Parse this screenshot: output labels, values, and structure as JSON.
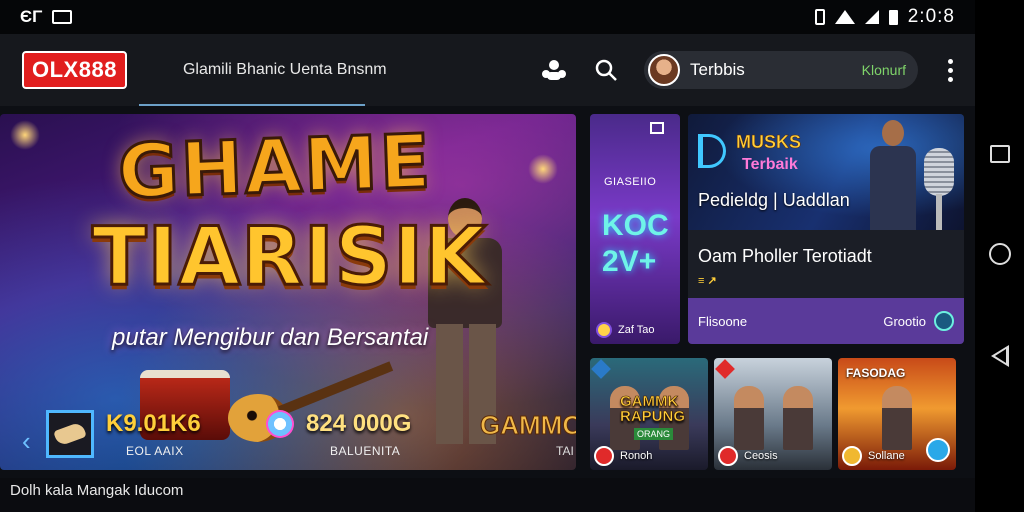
{
  "status_bar": {
    "left_text": "ЄΓ",
    "clock": "2:0:8"
  },
  "header": {
    "logo": "OLX888",
    "nav_text": "Glamili Bhanic  Uenta  Bnsnm",
    "profile_name": "Terbbis",
    "profile_status": "Klonurf"
  },
  "hero": {
    "title_line1": "GHAME",
    "title_line2": "TIARISIK",
    "subtitle": "putar Mengibur dan Bersantai",
    "stat1_value": "K9.01K6",
    "stat1_label": "EOL AAIX",
    "stat2_value": "824 000G",
    "stat2_label": "BALUENITA",
    "side_title": "GAMMON",
    "side_sub": "TAI"
  },
  "card_violet": {
    "label": "GIASEIIO",
    "big_line1": "KOC",
    "big_line2": "2V+",
    "foot": "Zaf Tao"
  },
  "feature": {
    "brand_line1": "MUSKS",
    "brand_line2": "Terbaik",
    "caption": "Pedieldg | Uaddlan",
    "heading": "Oam Pholler Terotiadt",
    "tag": "≡ ↗",
    "bar_label": "Flisoone",
    "bar_action": "Grootio"
  },
  "thumbs": [
    {
      "title": "GAMMK\nRAPUNG",
      "sub": "ORANG",
      "foot": "Ronoh"
    },
    {
      "top": "",
      "foot": "Ceosis"
    },
    {
      "top": "FASODAG",
      "foot": "Sollane"
    }
  ],
  "footer": {
    "caption": "Dolh kala Mangak Iducom"
  },
  "colors": {
    "logo_red": "#e11e1e",
    "accent_gold": "#ffc52e",
    "status_green": "#7fd46a",
    "violet": "#7a3ac8"
  }
}
